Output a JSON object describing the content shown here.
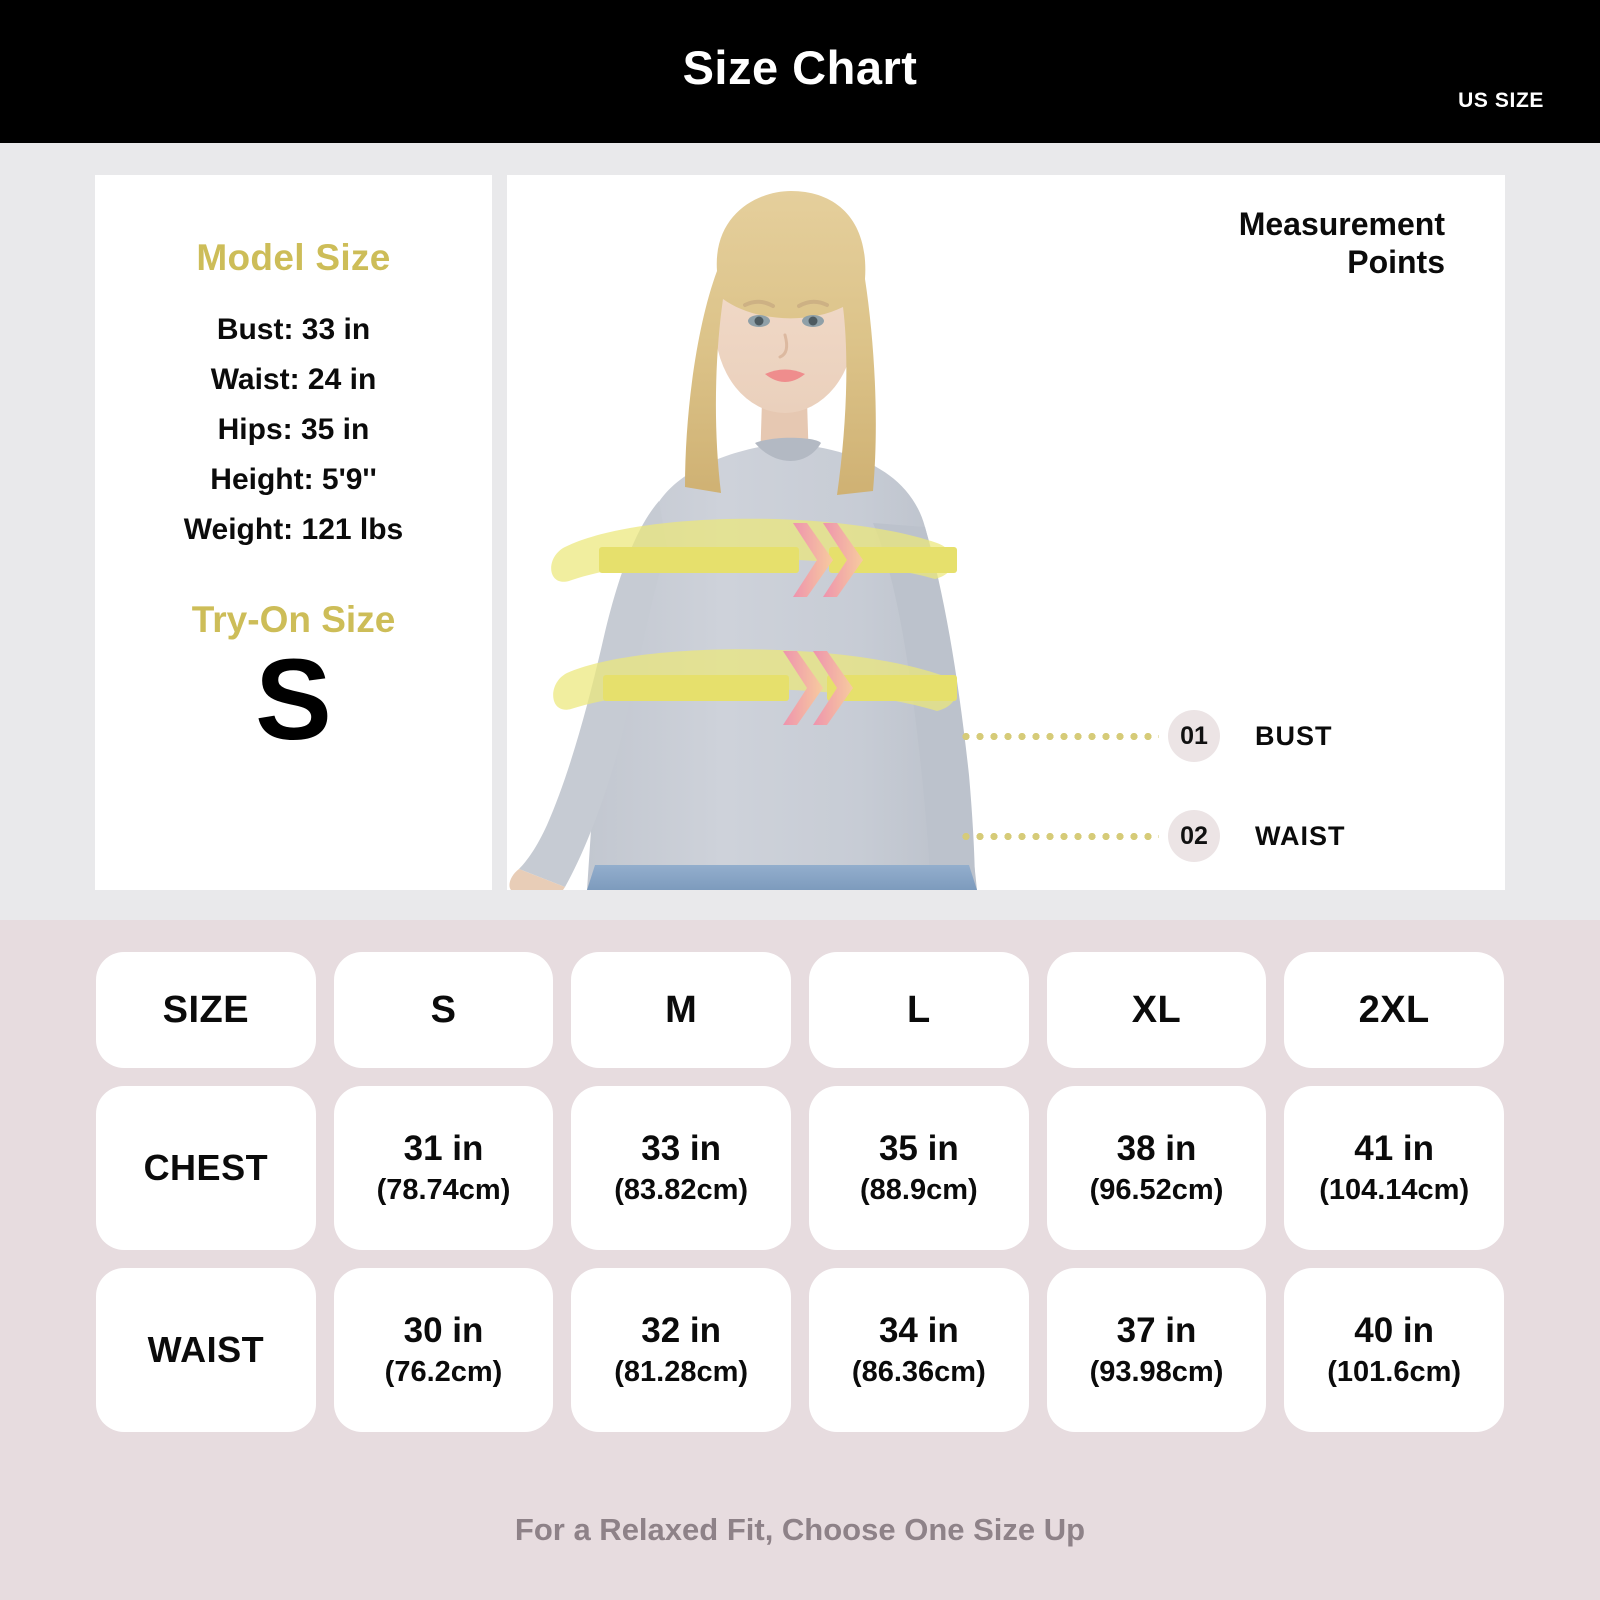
{
  "header": {
    "title": "Size Chart",
    "unit_badge": "US SIZE"
  },
  "model_panel": {
    "model_size_title": "Model Size",
    "stats": [
      "Bust: 33 in",
      "Waist: 24 in",
      "Hips: 35 in",
      "Height: 5'9''",
      "Weight: 121 lbs"
    ],
    "try_on_title": "Try-On Size",
    "try_on_size": "S"
  },
  "measurement_panel": {
    "title_line1": "Measurement",
    "title_line2": "Points",
    "points": [
      {
        "number": "01",
        "label": "BUST"
      },
      {
        "number": "02",
        "label": "WAIST"
      }
    ]
  },
  "chart_data": {
    "type": "table",
    "title": "Size Chart",
    "unit_system": "US SIZE",
    "corner_label": "SIZE",
    "categories": [
      "S",
      "M",
      "L",
      "XL",
      "2XL"
    ],
    "rows": [
      {
        "label": "CHEST",
        "values_in": [
          31,
          33,
          35,
          38,
          41
        ],
        "values_cm": [
          78.74,
          83.82,
          88.9,
          96.52,
          104.14
        ],
        "cells": [
          {
            "inches": "31 in",
            "cm": "(78.74cm)"
          },
          {
            "inches": "33 in",
            "cm": "(83.82cm)"
          },
          {
            "inches": "35 in",
            "cm": "(88.9cm)"
          },
          {
            "inches": "38 in",
            "cm": "(96.52cm)"
          },
          {
            "inches": "41 in",
            "cm": "(104.14cm)"
          }
        ]
      },
      {
        "label": "WAIST",
        "values_in": [
          30,
          32,
          34,
          37,
          40
        ],
        "values_cm": [
          76.2,
          81.28,
          86.36,
          93.98,
          101.6
        ],
        "cells": [
          {
            "inches": "30 in",
            "cm": "(76.2cm)"
          },
          {
            "inches": "32 in",
            "cm": "(81.28cm)"
          },
          {
            "inches": "34 in",
            "cm": "(86.36cm)"
          },
          {
            "inches": "37 in",
            "cm": "(93.98cm)"
          },
          {
            "inches": "40 in",
            "cm": "(101.6cm)"
          }
        ]
      }
    ]
  },
  "footnote": "For a Relaxed Fit, Choose One Size Up",
  "colors": {
    "header_bg": "#000000",
    "upper_bg": "#e9e9eb",
    "lower_bg": "#e7dcdf",
    "accent_gold": "#cdbd58",
    "band_yellow": "#e8e06a",
    "chevron_pink": "#ef9bb0",
    "chevron_peach": "#f5c79a",
    "badge_bg": "#ece4e5",
    "footnote_text": "#8e8288",
    "shirt_gray": "#c8ccd4",
    "jeans_blue": "#8aa6c8"
  }
}
